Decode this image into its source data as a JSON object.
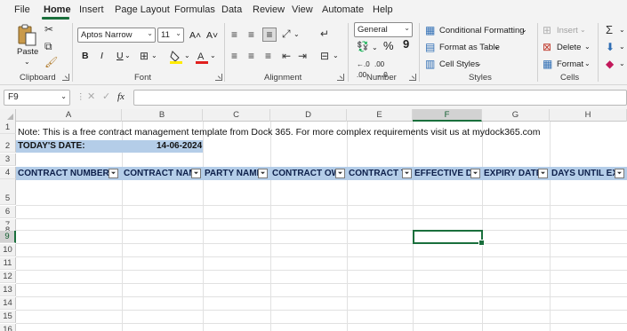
{
  "menu": [
    "File",
    "Home",
    "Insert",
    "Page Layout",
    "Formulas",
    "Data",
    "Review",
    "View",
    "Automate",
    "Help"
  ],
  "ribbon": {
    "clipboard": {
      "paste": "Paste",
      "label": "Clipboard"
    },
    "font": {
      "name": "Aptos Narrow",
      "size": "11",
      "bold": "B",
      "italic": "I",
      "underline": "U",
      "grow": "A˄",
      "shrink": "A˅",
      "label": "Font"
    },
    "alignment": {
      "label": "Alignment"
    },
    "number": {
      "format": "General",
      "percent": "%",
      "comma": "9",
      "label": "Number"
    },
    "styles": {
      "conditional": "Conditional Formatting",
      "format_table": "Format as Table",
      "cell_styles": "Cell Styles",
      "label": "Styles"
    },
    "cells": {
      "insert": "Insert",
      "delete": "Delete",
      "format": "Format",
      "label": "Cells"
    }
  },
  "formula_bar": {
    "name_box": "F9",
    "fx": "fx",
    "content": ""
  },
  "columns": [
    "A",
    "B",
    "C",
    "D",
    "E",
    "F",
    "G",
    "H"
  ],
  "selected_column": "F",
  "rows": [
    "1",
    "2",
    "3",
    "4",
    "5",
    "6",
    "7",
    "8",
    "9",
    "10",
    "11",
    "12",
    "13",
    "14",
    "15",
    "16"
  ],
  "selected_row": "9",
  "sheet": {
    "note": "Note: This is a free contract management template from Dock 365. For more complex requirements visit us at mydock365.com",
    "todays_date_label": "TODAY'S DATE:",
    "todays_date_value": "14-06-2024",
    "headers": [
      "CONTRACT NUMBER",
      "CONTRACT NAME",
      "PARTY NAME",
      "CONTRACT OWNER",
      "CONTRACT TYPE",
      "EFFECTIVE DATE",
      "EXPIRY DATE",
      "DAYS UNTIL EXPIRY"
    ]
  },
  "colors": {
    "accent_green": "#1a6f3c",
    "header_fill": "#b4cde8",
    "ribbon_bg": "#f3f3f3"
  }
}
